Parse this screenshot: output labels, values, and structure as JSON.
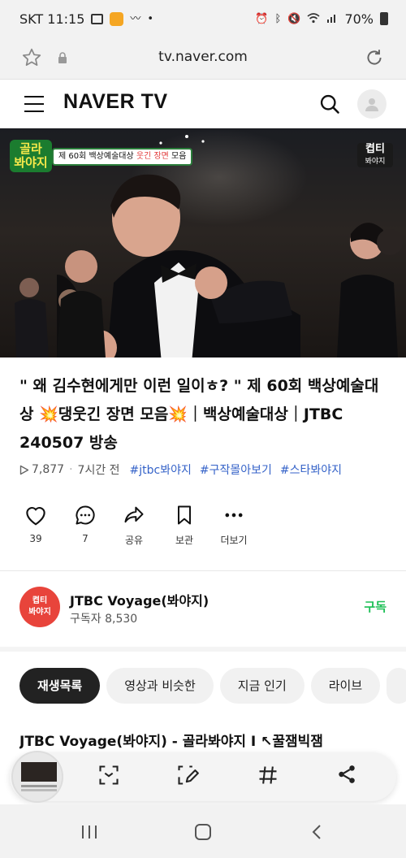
{
  "status_bar": {
    "carrier_time": "SKT 11:15",
    "battery": "70%"
  },
  "browser": {
    "url": "tv.naver.com"
  },
  "header": {
    "logo": "NAVER TV"
  },
  "video": {
    "badge_left": "골라\n봐야지",
    "badge_text_pre": "제 60회 백상예술대상 ",
    "badge_text_highlight": "웃긴 장면",
    "badge_text_post": " 모음",
    "badge_right_top": "켭티",
    "badge_right_bottom": "봐야지"
  },
  "title": "\" 왜 김수현에게만 이런 일이ㅎ? \" 제 60회 백상예술대상 💥댕웃긴 장면 모음💥｜백상예술대상｜JTBC 240507 방송",
  "meta": {
    "views": "7,877",
    "time": "7시간 전",
    "tags": [
      "#jtbc봐야지",
      "#구작몰아보기",
      "#스타봐야지"
    ]
  },
  "actions": [
    {
      "label": "39",
      "icon": "heart-icon"
    },
    {
      "label": "7",
      "icon": "comment-icon"
    },
    {
      "label": "공유",
      "icon": "share-icon"
    },
    {
      "label": "보관",
      "icon": "bookmark-icon"
    },
    {
      "label": "더보기",
      "icon": "more-icon"
    }
  ],
  "channel": {
    "avatar_text": "켭티\n봐야지",
    "name": "JTBC Voyage(봐야지)",
    "subscribers": "구독자 8,530",
    "subscribe_label": "구독"
  },
  "tabs": [
    "재생목록",
    "영상과 비슷한",
    "지금 인기",
    "라이브"
  ],
  "playlist": {
    "title": "JTBC Voyage(봐야지) - 골라봐야지 I  ↖꿀잼빅잼"
  },
  "colors": {
    "accent_green": "#1cbf55",
    "tag_blue": "#3462c8"
  }
}
